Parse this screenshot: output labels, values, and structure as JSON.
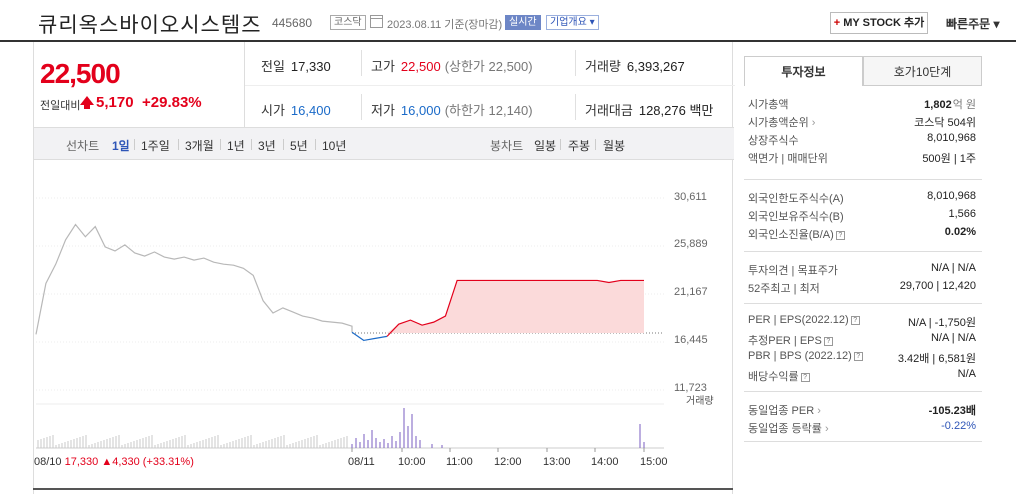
{
  "header": {
    "title": "큐리옥스바이오시스템즈",
    "code": "445680",
    "market": "코스닥",
    "date": "2023.08.11 기준(장마감)",
    "realtime": "실시간",
    "corp_overview": "기업개요 ▾",
    "mystock_plus": "+",
    "mystock_label": "MY STOCK 추가",
    "quick_order": "빠른주문 ▾"
  },
  "price": {
    "current": "22,500",
    "vs_label": "전일대비",
    "change": "5,170",
    "change_pct": "+29.83%"
  },
  "stats": {
    "prev_label": "전일",
    "prev": "17,330",
    "high_label": "고가",
    "high": "22,500",
    "upper_limit": "(상한가 22,500)",
    "volume_label": "거래량",
    "volume": "6,393,267",
    "open_label": "시가",
    "open": "16,400",
    "low_label": "저가",
    "low": "16,000",
    "lower_limit": "(하한가 12,140)",
    "amount_label": "거래대금",
    "amount": "128,276 백만"
  },
  "tabs": {
    "line_label": "선차트",
    "line": [
      "1일",
      "1주일",
      "3개월",
      "1년",
      "3년",
      "5년",
      "10년"
    ],
    "candle_label": "봉차트",
    "candle": [
      "일봉",
      "주봉",
      "월봉"
    ]
  },
  "chart_data": {
    "type": "line",
    "y_ticks": [
      "30,611",
      "25,889",
      "21,167",
      "16,445",
      "11,723"
    ],
    "ylim": [
      11723,
      30611
    ],
    "x_ticks": [
      "08/11",
      "10:00",
      "11:00",
      "12:00",
      "13:00",
      "14:00",
      "15:00"
    ],
    "volume_label": "거래량",
    "footer": {
      "date": "08/10",
      "price": "17,330",
      "change": "▲4,330",
      "pct": "(+33.31%)"
    },
    "prev_close": 17330,
    "series": [
      {
        "values": [
          17200,
          22200,
          24100,
          26500,
          28000,
          26800,
          27800,
          25800,
          25400,
          26000,
          25200,
          24900,
          25300,
          24800,
          24600,
          24800,
          24500,
          24700,
          24300,
          24100,
          24000,
          23700,
          23000,
          20500,
          19300,
          19800,
          19400,
          19000,
          18800,
          18500,
          18400,
          18300,
          18000,
          17400,
          16600,
          16800,
          17000,
          18200,
          18600,
          18100,
          18400,
          19000,
          22500,
          22500,
          22500,
          22500,
          22500,
          22500,
          22500,
          22500,
          22500,
          22500,
          22500,
          22500,
          22500,
          22300,
          22500,
          22500,
          22500
        ]
      }
    ]
  },
  "info": {
    "tab_active": "투자정보",
    "tab_other": "호가10단계",
    "market_cap_label": "시가총액",
    "market_cap": "1,802",
    "market_cap_unit": "억 원",
    "cap_rank_label": "시가총액순위",
    "cap_rank": "코스닥 504위",
    "shares_label": "상장주식수",
    "shares": "8,010,968",
    "face_label": "액면가 | 매매단위",
    "face": "500원 | 1주",
    "foreign_limit_label": "외국인한도주식수(A)",
    "foreign_limit": "8,010,968",
    "foreign_hold_label": "외국인보유주식수(B)",
    "foreign_hold": "1,566",
    "foreign_ratio_label": "외국인소진율(B/A)",
    "foreign_ratio": "0.02%",
    "opinion_label": "투자의견 | 목표주가",
    "opinion": "N/A | N/A",
    "w52_label": "52주최고 | 최저",
    "w52": "29,700 | 12,420",
    "per_label": "PER | EPS(2022.12)",
    "per": "N/A | -1,750원",
    "est_per_label": "추정PER | EPS",
    "est_per": "N/A | N/A",
    "pbr_label": "PBR | BPS (2022.12)",
    "pbr": "3.42배 | 6,581원",
    "div_label": "배당수익률",
    "div": "N/A",
    "ind_per_label": "동일업종 PER",
    "ind_per": "-105.23배",
    "ind_rate_label": "동일업종 등락률",
    "ind_rate": "-0.22%"
  }
}
